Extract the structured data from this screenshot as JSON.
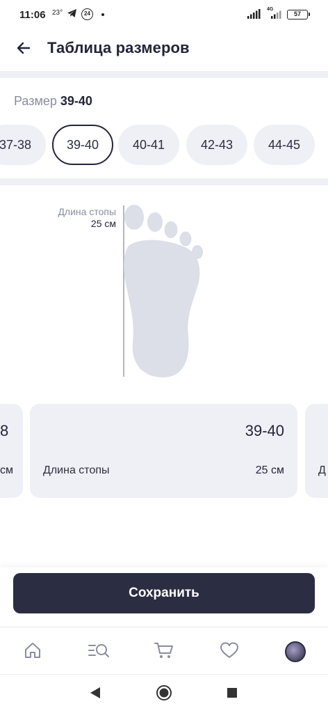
{
  "status_bar": {
    "time": "11:06",
    "temperature": "23°",
    "badge": "24",
    "network": "4G",
    "battery": "57"
  },
  "header": {
    "title": "Таблица размеров",
    "back_icon": "arrow-left-icon"
  },
  "size_selector": {
    "label": "Размер",
    "selected": "39-40",
    "options": [
      "37-38",
      "39-40",
      "40-41",
      "42-43",
      "44-45"
    ]
  },
  "foot": {
    "param_label": "Длина стопы",
    "param_value": "25 см"
  },
  "cards": {
    "prev": {
      "size_fragment": "8",
      "value_fragment": "см"
    },
    "current": {
      "size": "39-40",
      "param_label": "Длина стопы",
      "param_value": "25 см"
    },
    "next": {
      "label_fragment": "Д"
    }
  },
  "save_button": {
    "label": "Сохранить"
  },
  "bottom_nav": {
    "items": [
      "home-icon",
      "search-catalog-icon",
      "cart-icon",
      "heart-icon",
      "profile-avatar"
    ]
  },
  "system_nav": [
    "back-triangle-icon",
    "home-circle-icon",
    "recents-square-icon"
  ],
  "colors": {
    "primary_dark": "#2b2d42",
    "chip_bg": "#eef0f5",
    "muted_text": "#8a8ca0",
    "foot_fill": "#dcdee8"
  }
}
